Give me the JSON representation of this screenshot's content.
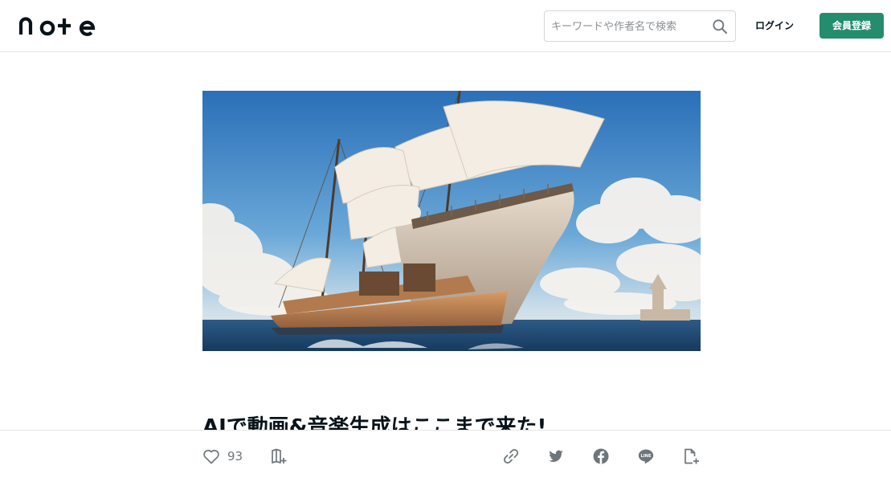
{
  "header": {
    "logo_text": "note",
    "search_placeholder": "キーワードや作者名で検索",
    "login_label": "ログイン",
    "signup_label": "会員登録",
    "accent_color": "#258d6e"
  },
  "article": {
    "title": "AIで動画&音楽生成はここまで来た!",
    "hero_image": "anime-style-sailing-ship-at-sea"
  },
  "footer": {
    "like_count": "93",
    "icons": [
      "heart-icon",
      "magazine-add-icon",
      "link-icon",
      "twitter-icon",
      "facebook-icon",
      "line-icon",
      "note-add-icon"
    ]
  }
}
